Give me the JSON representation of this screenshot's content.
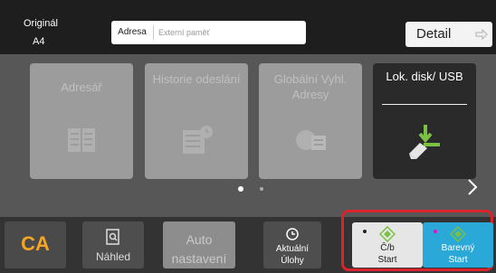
{
  "header": {
    "original_label": "Originál",
    "original_size": "A4",
    "address_label": "Adresa",
    "address_placeholder": "Externí paměť",
    "detail_label": "Detail"
  },
  "tiles": [
    {
      "label": "Adresář",
      "enabled": false,
      "icon": "address-book-icon"
    },
    {
      "label": "Historie odeslání",
      "enabled": false,
      "icon": "send-history-icon"
    },
    {
      "label": "Globální Vyhl. Adresy",
      "enabled": false,
      "icon": "global-address-icon"
    },
    {
      "label": "Lok. disk/ USB",
      "enabled": true,
      "icon": "usb-download-icon"
    }
  ],
  "pagination": {
    "pages": 2,
    "current": 1
  },
  "bottom": {
    "ca_label": "CA",
    "preview_label": "Náhled",
    "auto_line1": "Auto",
    "auto_line2": "nastavení",
    "jobs_line1": "Aktuální",
    "jobs_line2": "Úlohy",
    "bw_start_line1": "Č/b",
    "bw_start_line2": "Start",
    "color_start_line1": "Barevný",
    "color_start_line2": "Start"
  },
  "colors": {
    "ca": "#f5a524",
    "color_start": "#2aa8d8",
    "highlight": "#d9232d",
    "start_icon": "#7ac143"
  }
}
